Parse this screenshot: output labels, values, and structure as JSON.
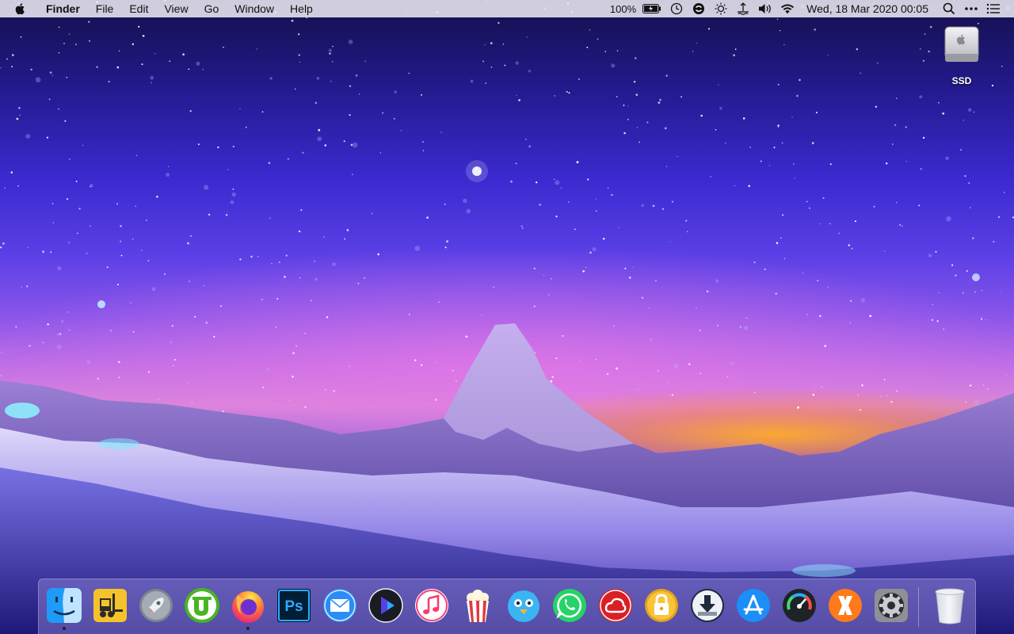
{
  "menubar": {
    "app_name": "Finder",
    "menus": [
      "File",
      "Edit",
      "View",
      "Go",
      "Window",
      "Help"
    ],
    "battery_percent": "100%",
    "datetime": "Wed, 18 Mar 2020  00:05",
    "status_icons": [
      "battery-icon",
      "time-machine-icon",
      "sync-icon",
      "brightness-icon",
      "network-gauge-icon",
      "volume-icon",
      "wifi-icon"
    ]
  },
  "desktop": {
    "ssd_label": "SSD"
  },
  "dock": {
    "apps": [
      {
        "name": "Finder",
        "icon": "finder-icon",
        "running": true
      },
      {
        "name": "Forklift",
        "icon": "forklift-icon",
        "running": false
      },
      {
        "name": "Launchpad",
        "icon": "launchpad-icon",
        "running": false
      },
      {
        "name": "uTorrent",
        "icon": "utorrent-icon",
        "running": false
      },
      {
        "name": "Firefox",
        "icon": "firefox-icon",
        "running": true
      },
      {
        "name": "Photoshop",
        "icon": "photoshop-icon",
        "running": false
      },
      {
        "name": "Mail",
        "icon": "mail-icon",
        "running": false
      },
      {
        "name": "Infuse",
        "icon": "infuse-icon",
        "running": false
      },
      {
        "name": "Music",
        "icon": "music-icon",
        "running": false
      },
      {
        "name": "Popcorn Time",
        "icon": "popcorn-icon",
        "running": false
      },
      {
        "name": "Tweetbot",
        "icon": "tweetbot-icon",
        "running": false
      },
      {
        "name": "WhatsApp",
        "icon": "whatsapp-icon",
        "running": false
      },
      {
        "name": "Creative Cloud",
        "icon": "creative-cloud-icon",
        "running": false
      },
      {
        "name": "Encrypto",
        "icon": "lock-icon",
        "running": false
      },
      {
        "name": "Downloader",
        "icon": "download-icon",
        "running": false
      },
      {
        "name": "App Store",
        "icon": "app-store-icon",
        "running": false
      },
      {
        "name": "iStat Menus",
        "icon": "gauge-icon",
        "running": false
      },
      {
        "name": "CrossOver",
        "icon": "crossover-icon",
        "running": false
      },
      {
        "name": "System Preferences",
        "icon": "system-preferences-icon",
        "running": false
      },
      {
        "name": "Trash",
        "icon": "trash-icon",
        "running": false
      }
    ]
  },
  "colors": {
    "accent_sunset": "#ffaa28",
    "sky_top": "#14104a",
    "sky_mid": "#5a3fe6"
  }
}
